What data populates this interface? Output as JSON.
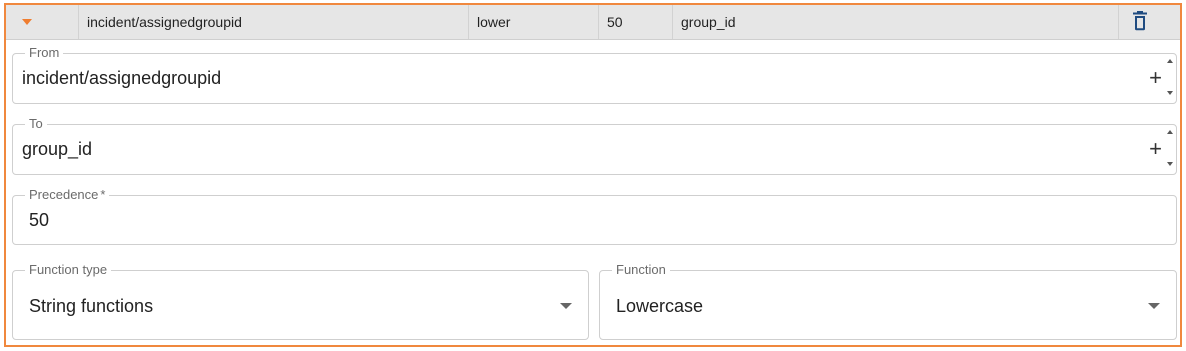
{
  "header": {
    "path": "incident/assignedgroupid",
    "function": "lower",
    "precedence": "50",
    "target": "group_id"
  },
  "form": {
    "from": {
      "label": "From",
      "value": "incident/assignedgroupid"
    },
    "to": {
      "label": "To",
      "value": "group_id"
    },
    "precedence": {
      "label": "Precedence",
      "required_marker": "*",
      "value": "50"
    },
    "function_type": {
      "label": "Function type",
      "value": "String functions"
    },
    "function": {
      "label": "Function",
      "value": "Lowercase"
    }
  },
  "icons": {
    "expand": "caret-down-icon",
    "delete": "trash-icon",
    "add": "plus-icon",
    "spinner": "spinner-arrows-icon",
    "dropdown": "dropdown-arrow-icon"
  },
  "colors": {
    "accent": "#f0883e",
    "header_bg": "#e6e6e6"
  }
}
